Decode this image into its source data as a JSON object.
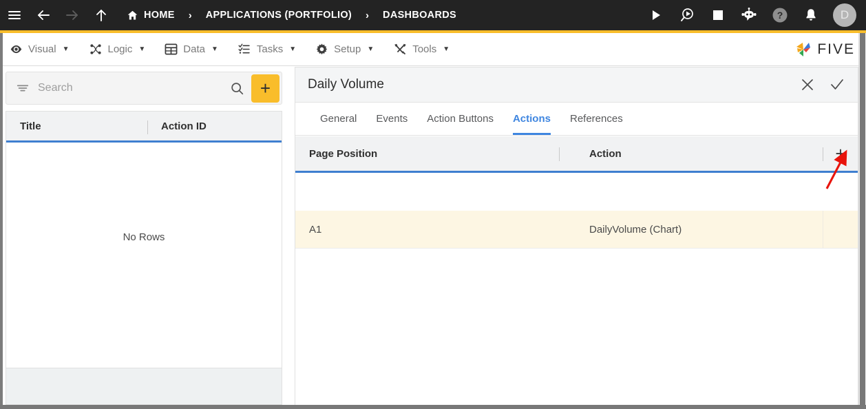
{
  "topbar": {
    "nav_icons": [
      {
        "name": "hamburger-menu-icon",
        "label": "Menu"
      },
      {
        "name": "back-arrow-icon",
        "label": "Back"
      },
      {
        "name": "forward-arrow-icon",
        "label": "Forward"
      },
      {
        "name": "up-arrow-icon",
        "label": "Up"
      }
    ],
    "breadcrumb": [
      {
        "label": "HOME",
        "icon": "home-icon"
      },
      {
        "label": "APPLICATIONS (PORTFOLIO)",
        "icon": ""
      },
      {
        "label": "DASHBOARDS",
        "icon": ""
      }
    ],
    "separator": "›",
    "right_icons": [
      {
        "name": "run-play-icon",
        "label": "Run"
      },
      {
        "name": "debug-magnifier-play-icon",
        "label": "Debug"
      },
      {
        "name": "stop-square-icon",
        "label": "Stop"
      },
      {
        "name": "chat-bot-icon",
        "label": "Assistant"
      },
      {
        "name": "help-question-icon",
        "label": "Help"
      },
      {
        "name": "notifications-bell-icon",
        "label": "Notifications"
      }
    ],
    "avatar_initial": "D",
    "background": "#232323",
    "accent_stripe": "#f9bd2b"
  },
  "menubar": {
    "items": [
      {
        "label": "Visual",
        "icon": "eye-icon"
      },
      {
        "label": "Logic",
        "icon": "logic-nodes-icon"
      },
      {
        "label": "Data",
        "icon": "table-grid-icon"
      },
      {
        "label": "Tasks",
        "icon": "checklist-icon"
      },
      {
        "label": "Setup",
        "icon": "gear-icon"
      },
      {
        "label": "Tools",
        "icon": "tools-icon"
      }
    ],
    "caret": "▼",
    "logo_text": "FIVE",
    "logo_colors": [
      "#f4a71d",
      "#3c78d8",
      "#34a853",
      "#e8453c"
    ]
  },
  "left_panel": {
    "search": {
      "placeholder": "Search",
      "value": ""
    },
    "filter_icon": "filter-lines-icon",
    "search_icon": "search-magnifier-icon",
    "add_button_label": "+",
    "add_button_color": "#f9bd2b",
    "columns": [
      "Title",
      "Action ID"
    ],
    "rows": [],
    "empty_message": "No Rows"
  },
  "right_panel": {
    "title": "Daily Volume",
    "header_actions": [
      {
        "name": "close-icon",
        "label": "Close"
      },
      {
        "name": "confirm-check-icon",
        "label": "Save"
      }
    ],
    "tabs": [
      {
        "label": "General",
        "active": false
      },
      {
        "label": "Events",
        "active": false
      },
      {
        "label": "Action Buttons",
        "active": false
      },
      {
        "label": "Actions",
        "active": true
      },
      {
        "label": "References",
        "active": false
      }
    ],
    "active_tab_color": "#3f86e0",
    "grid": {
      "columns": [
        "Page Position",
        "Action"
      ],
      "add_button_label": "+",
      "rows": [
        {
          "page_position": "A1",
          "action": "DailyVolume (Chart)"
        }
      ],
      "row_highlight_color": "#fdf6e3",
      "header_underline_color": "#3f7fd0"
    }
  },
  "annotation": {
    "arrow_color": "#e8140c",
    "points_to": "add-action-row-button"
  }
}
